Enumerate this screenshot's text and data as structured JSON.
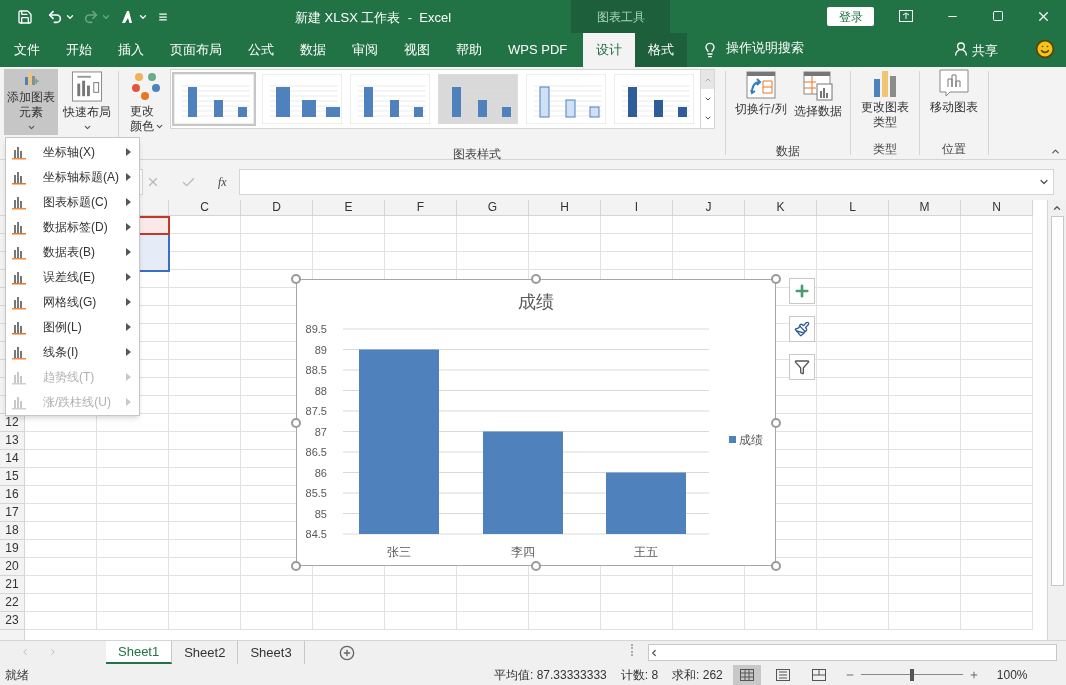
{
  "title_bar": {
    "title": "新建 XLSX 工作表  -  Excel",
    "context_group": "图表工具",
    "sign_in": "登录"
  },
  "tabs": [
    {
      "label": "文件",
      "selected": false,
      "contextual": false
    },
    {
      "label": "开始",
      "selected": false,
      "contextual": false
    },
    {
      "label": "插入",
      "selected": false,
      "contextual": false
    },
    {
      "label": "页面布局",
      "selected": false,
      "contextual": false
    },
    {
      "label": "公式",
      "selected": false,
      "contextual": false
    },
    {
      "label": "数据",
      "selected": false,
      "contextual": false
    },
    {
      "label": "审阅",
      "selected": false,
      "contextual": false
    },
    {
      "label": "视图",
      "selected": false,
      "contextual": false
    },
    {
      "label": "帮助",
      "selected": false,
      "contextual": false
    },
    {
      "label": "WPS PDF",
      "selected": false,
      "contextual": false
    },
    {
      "label": "设计",
      "selected": true,
      "contextual": true
    },
    {
      "label": "格式",
      "selected": false,
      "contextual": true
    }
  ],
  "tell_me": "操作说明搜索",
  "share": "共享",
  "ribbon": {
    "add_element": {
      "label": "添加图表元素",
      "pressed": true
    },
    "quick_layout": "快速布局",
    "change_colors": "更改颜色",
    "styles": [
      {
        "selected": true
      },
      {
        "selected": false
      },
      {
        "selected": false
      },
      {
        "selected": false
      },
      {
        "selected": false
      },
      {
        "selected": false
      }
    ],
    "styles_group": "图表样式",
    "switch_row_col": "切换行/列",
    "select_data": "选择数据",
    "data_group": "数据",
    "change_type": "更改图表类型",
    "type_group": "类型",
    "move_chart": "移动图表",
    "location_group": "位置"
  },
  "menu": [
    {
      "label": "坐标轴(X)",
      "disabled": false
    },
    {
      "label": "坐标轴标题(A)",
      "disabled": false
    },
    {
      "label": "图表标题(C)",
      "disabled": false
    },
    {
      "label": "数据标签(D)",
      "disabled": false
    },
    {
      "label": "数据表(B)",
      "disabled": false
    },
    {
      "label": "误差线(E)",
      "disabled": false
    },
    {
      "label": "网格线(G)",
      "disabled": false
    },
    {
      "label": "图例(L)",
      "disabled": false
    },
    {
      "label": "线条(I)",
      "disabled": false
    },
    {
      "label": "趋势线(T)",
      "disabled": true
    },
    {
      "label": "涨/跌柱线(U)",
      "disabled": true
    }
  ],
  "formula_bar": {
    "function_button": "fx"
  },
  "sheet": {
    "columns": [
      "C",
      "D",
      "E",
      "F",
      "G",
      "H",
      "I",
      "J",
      "K",
      "L",
      "M",
      "N"
    ],
    "rows": [
      "12",
      "13",
      "14",
      "15",
      "16",
      "17",
      "18",
      "19",
      "20",
      "21",
      "22",
      "23"
    ]
  },
  "chart": {
    "chart_data": {
      "type": "bar",
      "title": "成绩",
      "categories": [
        "张三",
        "李四",
        "王五"
      ],
      "series": [
        {
          "name": "成绩",
          "color": "#4f81bd",
          "values": [
            89,
            87,
            86
          ]
        }
      ],
      "grid": true,
      "ylim": [
        84.5,
        89.5
      ],
      "yticks": [
        84.5,
        85,
        85.5,
        86,
        86.5,
        87,
        87.5,
        88,
        88.5,
        89,
        89.5
      ]
    }
  },
  "sheet_tabs": [
    {
      "label": "Sheet1",
      "selected": true
    },
    {
      "label": "Sheet2",
      "selected": false
    },
    {
      "label": "Sheet3",
      "selected": false
    }
  ],
  "status_bar": {
    "ready": "就绪",
    "average": "平均值: 87.33333333",
    "count": "计数: 8",
    "sum": "求和: 262",
    "views": [
      {
        "selected": true
      },
      {
        "selected": false
      },
      {
        "selected": false
      }
    ],
    "zoom": {
      "level": 0.5
    },
    "zoom_reading": "100%"
  }
}
